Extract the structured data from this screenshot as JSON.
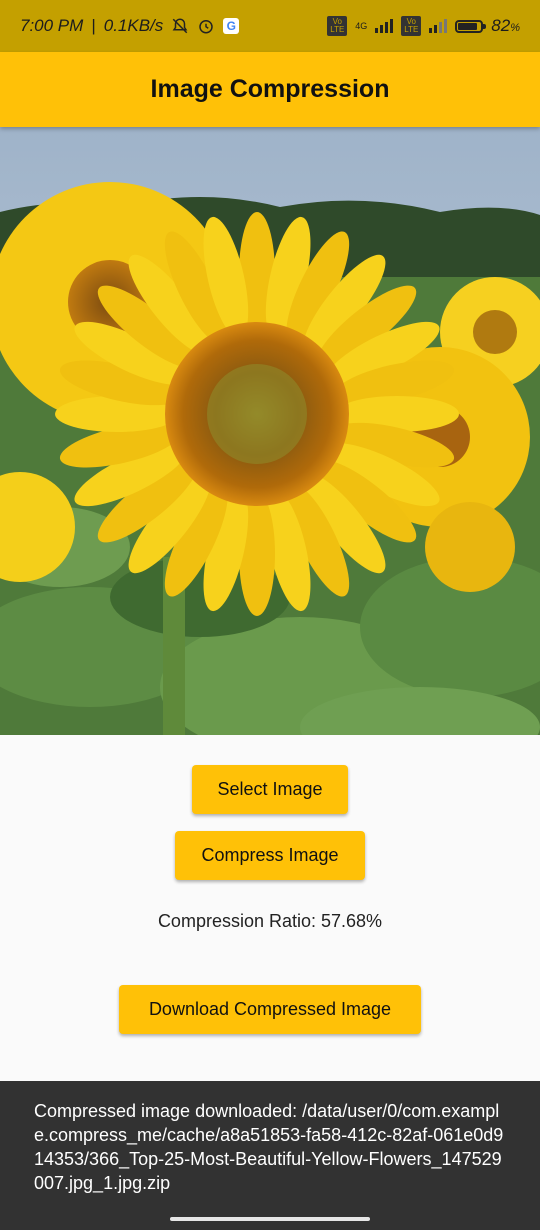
{
  "status_bar": {
    "time": "7:00 PM",
    "speed": "0.1KB/s",
    "battery": "82",
    "battery_unit": "%",
    "volte1": "Vo LTE",
    "volte2": "Vo LTE",
    "net_type": "4G",
    "icons": [
      "mute-bell-icon",
      "alarm-icon",
      "google-icon",
      "signal-icon",
      "battery-icon"
    ]
  },
  "app_bar": {
    "title": "Image Compression"
  },
  "image": {
    "description_icon": "sunflower-photo"
  },
  "buttons": {
    "select": "Select Image",
    "compress": "Compress Image",
    "download": "Download Compressed Image"
  },
  "compression": {
    "text": "Compression Ratio: 57.68%"
  },
  "snackbar": {
    "message": "Compressed image downloaded: /data/user/0/com.example.compress_me/cache/a8a51853-fa58-412c-82af-061e0d914353/366_Top-25-Most-Beautiful-Yellow-Flowers_147529007.jpg_1.jpg.zip"
  },
  "colors": {
    "accent": "#ffc107",
    "status_bar": "#c4a000",
    "snackbar": "#323232"
  }
}
